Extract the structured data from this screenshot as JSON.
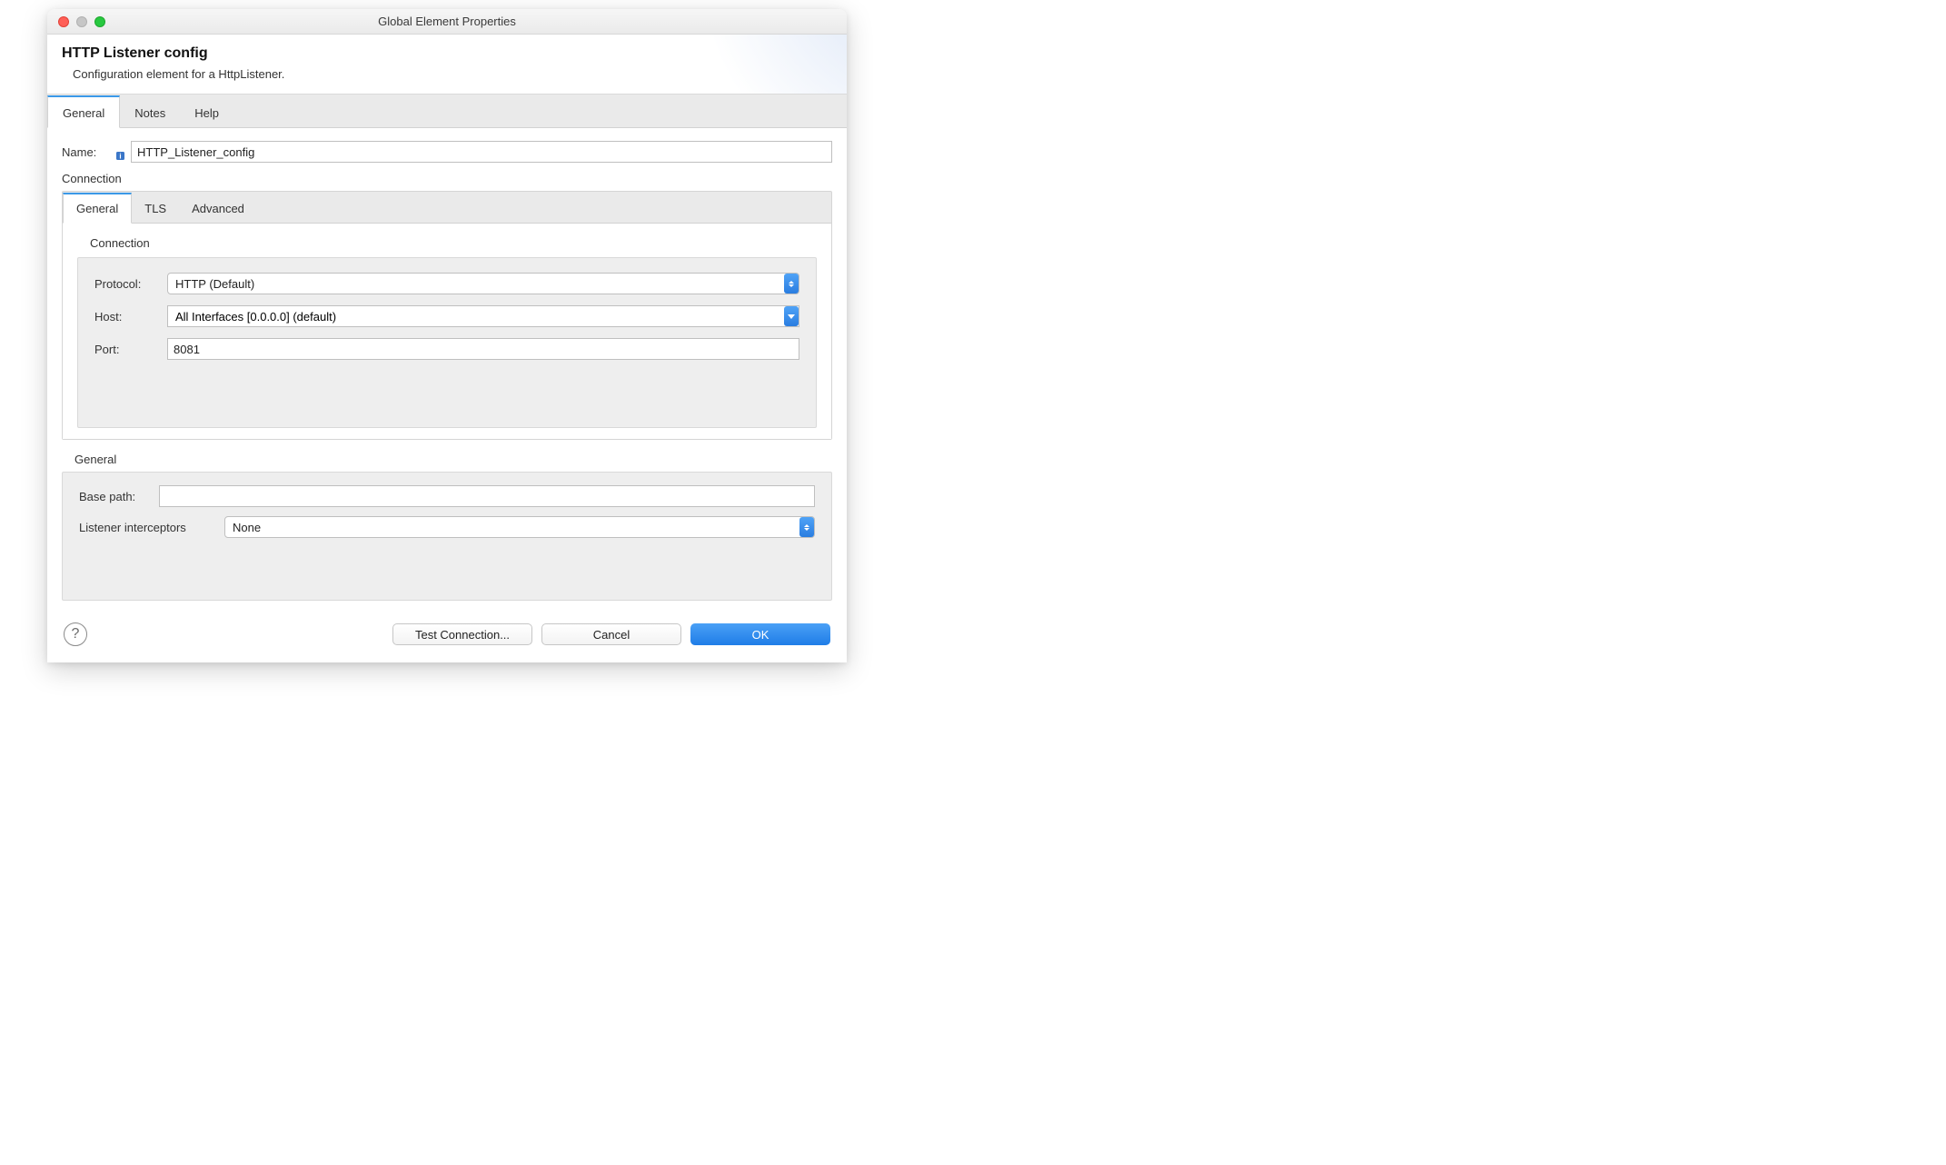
{
  "window": {
    "title": "Global Element Properties"
  },
  "header": {
    "title": "HTTP Listener config",
    "subtitle": "Configuration element for a HttpListener."
  },
  "tabs": {
    "general": "General",
    "notes": "Notes",
    "help": "Help"
  },
  "form": {
    "name_label": "Name:",
    "name_value": "HTTP_Listener_config",
    "connection_label": "Connection"
  },
  "connection_tabs": {
    "general": "General",
    "tls": "TLS",
    "advanced": "Advanced"
  },
  "connection_section": {
    "label": "Connection",
    "protocol_label": "Protocol:",
    "protocol_value": "HTTP (Default)",
    "host_label": "Host:",
    "host_value": "All Interfaces [0.0.0.0] (default)",
    "port_label": "Port:",
    "port_value": "8081"
  },
  "general_section": {
    "label": "General",
    "base_path_label": "Base path:",
    "base_path_value": "",
    "interceptors_label": "Listener interceptors",
    "interceptors_value": "None"
  },
  "footer": {
    "test_connection": "Test Connection...",
    "cancel": "Cancel",
    "ok": "OK"
  }
}
